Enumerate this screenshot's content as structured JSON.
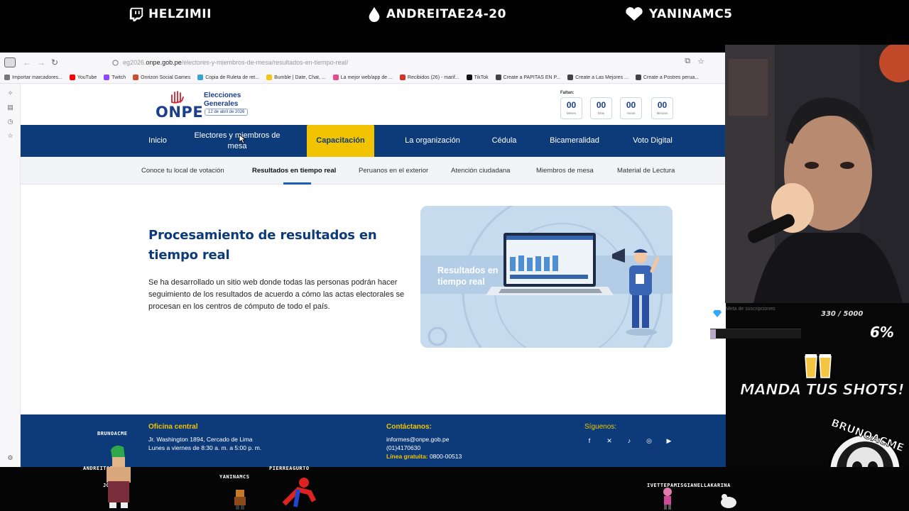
{
  "overlay": {
    "streamers": [
      {
        "name": "HELZIMII",
        "icon": "twitch-icon"
      },
      {
        "name": "ANDREITAE24-20",
        "icon": "drop-icon"
      },
      {
        "name": "YANINAMC5",
        "icon": "heart-icon"
      }
    ],
    "widget": {
      "label": "Meta de suscripciones",
      "count": "330 / 5000",
      "percent": "6%",
      "progress": 0.066
    },
    "shots_text": "MANDA TUS SHOTS!",
    "brand": "BRUNOACME",
    "chatters": [
      "BRUNOACME",
      "ANDREITAE24",
      "JOHANNYZ",
      "YANINAMCS",
      "PIERREAGURTO",
      "IVETTEPAMISGIANELLAKARINA"
    ]
  },
  "browser": {
    "url_prefix": "eg2026.",
    "url_domain": "onpe.gob.pe",
    "url_path": "/electores-y-miembros-de-mesa/resultados-en-tiempo-real/",
    "bookmarks": [
      {
        "label": "Importar marcadores...",
        "color": "#777777"
      },
      {
        "label": "YouTube",
        "color": "#ff0000"
      },
      {
        "label": "Twitch",
        "color": "#9146ff"
      },
      {
        "label": "Onrizon Social Games",
        "color": "#d24b2b"
      },
      {
        "label": "Copia de Ruleta de ret...",
        "color": "#3aa0d8"
      },
      {
        "label": "Bumble | Date, Chat, ...",
        "color": "#f5c518"
      },
      {
        "label": "La mejor web/app de ...",
        "color": "#e74c8b"
      },
      {
        "label": "Recibidos (26) - marif...",
        "color": "#d93025"
      },
      {
        "label": "TikTok",
        "color": "#111111"
      },
      {
        "label": "Create a PAPITAS EN P...",
        "color": "#444444"
      },
      {
        "label": "Create a Las Mejores ...",
        "color": "#444444"
      },
      {
        "label": "Create a Postres perua...",
        "color": "#444444"
      }
    ]
  },
  "site": {
    "logo": {
      "name": "ONPE",
      "title_line1": "Elecciones",
      "title_line2": "Generales",
      "date": "12 de abril de 2026"
    },
    "countdown": {
      "label": "Faltan:",
      "units": [
        {
          "value": "00",
          "unit": "Meses"
        },
        {
          "value": "00",
          "unit": "Días"
        },
        {
          "value": "00",
          "unit": "Horas"
        },
        {
          "value": "00",
          "unit": "Minutos"
        }
      ]
    },
    "main_nav": [
      {
        "label": "Inicio"
      },
      {
        "label": "Electores y miembros de mesa"
      },
      {
        "label": "Capacitación"
      },
      {
        "label": "La organización"
      },
      {
        "label": "Cédula"
      },
      {
        "label": "Bicameralidad"
      },
      {
        "label": "Voto Digital"
      }
    ],
    "sub_nav": [
      {
        "label": "Conoce tu local de votación"
      },
      {
        "label": "Resultados en tiempo real"
      },
      {
        "label": "Peruanos en el exterior"
      },
      {
        "label": "Atención ciudadana"
      },
      {
        "label": "Miembros de mesa"
      },
      {
        "label": "Material de Lectura"
      }
    ],
    "hero": {
      "title": "Procesamiento de resultados en tiempo real",
      "description": "Se ha desarrollado un sitio web donde todas las personas podrán hacer seguimiento de los resultados de acuerdo a cómo las actas electorales se procesan en los centros de cómputo de todo el país.",
      "image_text": "Resultados en tiempo real"
    },
    "footer": {
      "office_heading": "Oficina central",
      "office_address": "Jr. Washington 1894, Cercado de Lima",
      "office_hours": "Lunes a viernes de 8:30 a. m. a 5:00 p. m.",
      "contact_heading": "Contáctanos:",
      "contact_email": "informes@onpe.gob.pe",
      "contact_phone": "(01)4170630",
      "hotline_label": "Línea gratuita:",
      "hotline_number": "0800-00513",
      "social_heading": "Síguenos:",
      "social": [
        "facebook-icon",
        "x-icon",
        "tiktok-icon",
        "instagram-icon",
        "youtube-icon"
      ]
    }
  },
  "colors": {
    "navy": "#0d3b7a",
    "accent_yellow": "#f2c300",
    "link_blue": "#1a5fb4"
  }
}
